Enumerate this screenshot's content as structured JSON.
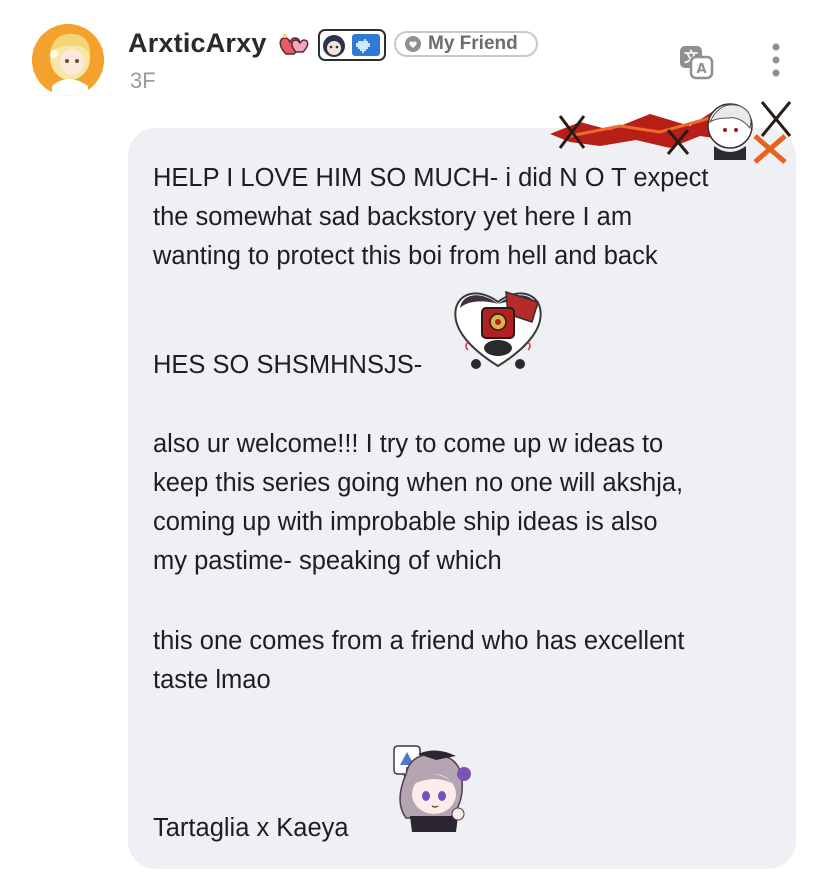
{
  "comment": {
    "author": {
      "username": "ArxticArxy",
      "friend_tag": "My Friend",
      "floor": "3F"
    },
    "actions": {
      "translate_icon": "translate-icon",
      "more_icon": "more-vertical-icon"
    },
    "body_lines": [
      "HELP I LOVE HIM SO MUCH- i did N O T expect",
      "the somewhat sad backstory yet here I am",
      "wanting to protect this boi from hell and back",
      "HES SO SHSMHNSJS-",
      "also ur welcome!!! I try to come up w ideas to",
      "keep this series going when no one will akshja,",
      "coming up with improbable ship ideas is also",
      "my pastime- speaking of which",
      "this one comes from a friend who has excellent",
      "taste lmao",
      "Tartaglia x Kaeya"
    ],
    "stickers": [
      "hat-sticker",
      "confused-girl-sticker"
    ],
    "colors": {
      "bubble_bg": "#eff0f3",
      "username": "#2a2a2c",
      "muted": "#9a9a9e",
      "deco_red": "#c0281e"
    }
  }
}
